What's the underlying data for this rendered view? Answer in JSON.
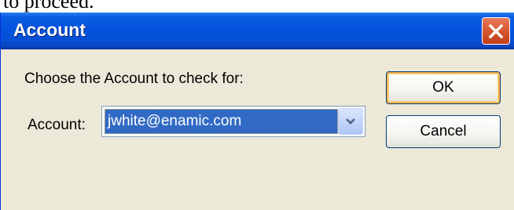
{
  "background_fragment": {
    "text": "to proceed."
  },
  "dialog": {
    "title": "Account",
    "prompt": "Choose the Account to check for:",
    "account_label": "Account:",
    "account_selected": "jwhite@enamic.com",
    "ok_label": "OK",
    "cancel_label": "Cancel"
  },
  "colors": {
    "titlebar": "#0553df",
    "dialog_face": "#ece9d8",
    "selection": "#316ac5",
    "close_button": "#d85b34",
    "default_button_focus": "#f8b34f"
  },
  "icons": {
    "close": "close-icon",
    "dropdown": "chevron-down-icon"
  }
}
